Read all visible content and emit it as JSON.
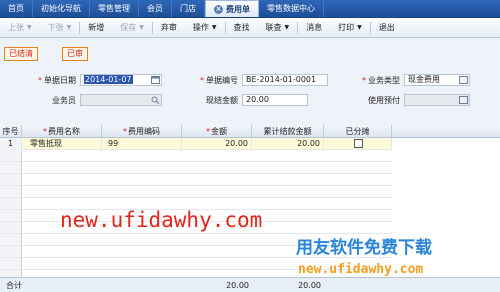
{
  "tabs": [
    {
      "label": "首页",
      "active": false
    },
    {
      "label": "初始化导航",
      "active": false
    },
    {
      "label": "零售管理",
      "active": false
    },
    {
      "label": "会员",
      "active": false
    },
    {
      "label": "门店",
      "active": false
    },
    {
      "label": "费用单",
      "active": true
    },
    {
      "label": "零售数据中心",
      "active": false
    }
  ],
  "toolbar": {
    "prev": "上张",
    "next": "下张",
    "add": "新增",
    "save": "保存",
    "abandon": "弃审",
    "operate": "操作",
    "search": "查找",
    "link_query": "联查",
    "message": "消息",
    "print": "打印",
    "exit": "退出"
  },
  "status_badges": {
    "settled": "已结清",
    "audited": "已审"
  },
  "form": {
    "doc_date_label": "单据日期",
    "doc_date_value": "2014-01-07",
    "doc_no_label": "单据编号",
    "doc_no_value": "BE-2014-01-0001",
    "biz_type_label": "业务类型",
    "biz_type_value": "现金费用",
    "clerk_label": "业务员",
    "clerk_value": "",
    "cash_amount_label": "现结金额",
    "cash_amount_value": "20.00",
    "prepay_label": "使用预付",
    "prepay_value": ""
  },
  "grid": {
    "headers": {
      "seq": "序号",
      "fee_name": "费用名称",
      "fee_code": "费用编码",
      "amount": "金额",
      "settled": "累计结款金额",
      "allocated": "已分摊"
    },
    "rows": [
      {
        "seq": "1",
        "fee_name": "零售抵现",
        "fee_code": "99",
        "amount": "20.00",
        "settled": "20.00",
        "allocated": false
      }
    ]
  },
  "watermark": {
    "url_main": "new.ufidawhy.com",
    "brand_cn": "用友软件免费下载",
    "url_small": "new.ufidawhy.com"
  },
  "footer": {
    "total_label": "合计",
    "total_amount": "20.00",
    "total_settled": "20.00"
  }
}
